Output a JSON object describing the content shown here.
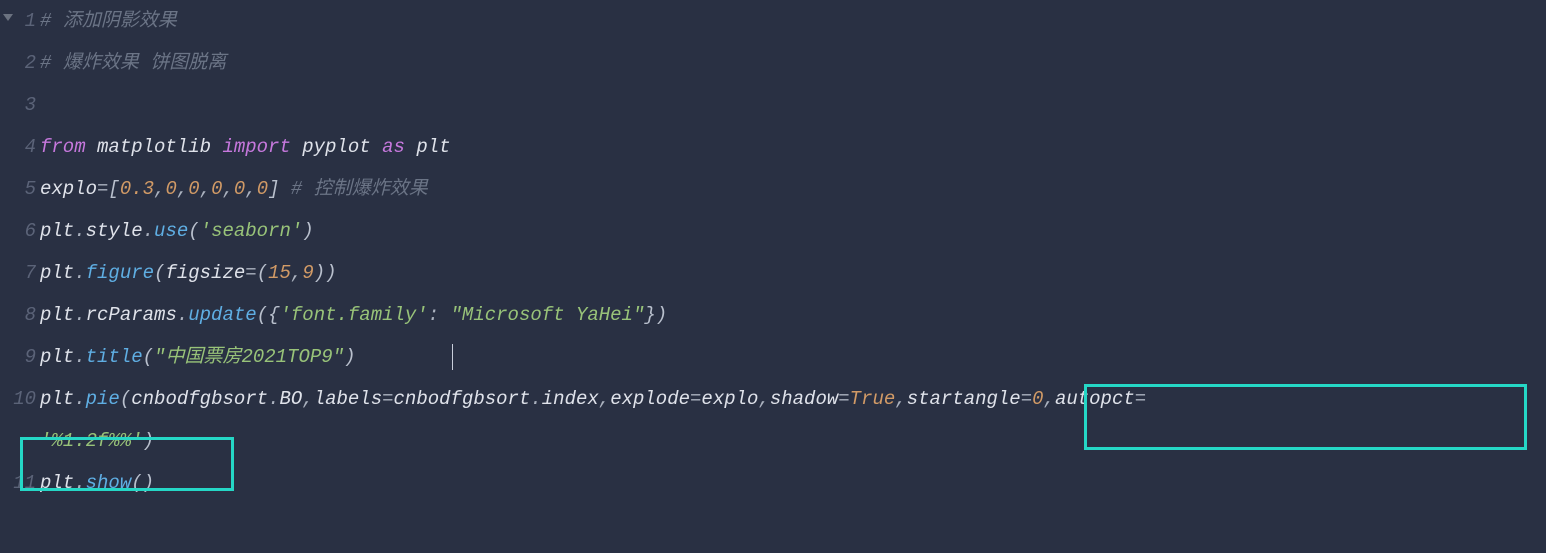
{
  "gutter": {
    "l1": "1",
    "l2": "2",
    "l3": "3",
    "l4": "4",
    "l5": "5",
    "l6": "6",
    "l7": "7",
    "l8": "8",
    "l9": "9",
    "l10": "10",
    "l11": "11"
  },
  "code": {
    "c1_hash": "#",
    "c1_sp": " ",
    "c1_txt": "添加阴影效果",
    "c2_hash": "#",
    "c2_sp": " ",
    "c2_txt": "爆炸效果 饼图脱离",
    "c4_from": "from",
    "c4_mod": "matplotlib",
    "c4_import": "import",
    "c4_sub": "pyplot",
    "c4_as": "as",
    "c4_alias": "plt",
    "c5_name": "explo",
    "c5_eq": "=",
    "c5_lb": "[",
    "c5_n0": "0.3",
    "c5_c": ",",
    "c5_n1": "0",
    "c5_n2": "0",
    "c5_n3": "0",
    "c5_n4": "0",
    "c5_n5": "0",
    "c5_rb": "]",
    "c5_sp": "  ",
    "c5_com": "# 控制爆炸效果",
    "c6_plt": "plt",
    "c6_dot": ".",
    "c6_style": "style",
    "c6_use": "use",
    "c6_lp": "(",
    "c6_arg": "'seaborn'",
    "c6_rp": ")",
    "c7_plt": "plt",
    "c7_dot": ".",
    "c7_fig": "figure",
    "c7_lp": "(",
    "c7_kw": "figsize",
    "c7_eq": "=",
    "c7_lp2": "(",
    "c7_n1": "15",
    "c7_c": ",",
    "c7_n2": "9",
    "c7_rp2": ")",
    "c7_rp": ")",
    "c8_plt": "plt",
    "c8_dot": ".",
    "c8_rc": "rcParams",
    "c8_upd": "update",
    "c8_lp": "(",
    "c8_lb": "{",
    "c8_key": "'font.family'",
    "c8_col": ":",
    "c8_val": "\"Microsoft YaHei\"",
    "c8_rb": "}",
    "c8_rp": ")",
    "c9_plt": "plt",
    "c9_dot": ".",
    "c9_title": "title",
    "c9_lp": "(",
    "c9_arg": "\"中国票房2021TOP9\"",
    "c9_rp": ")",
    "c10_plt": "plt",
    "c10_dot": ".",
    "c10_pie": "pie",
    "c10_lp": "(",
    "c10_a1a": "cnbodfgbsort",
    "c10_a1b": "BO",
    "c10_c": ",",
    "c10_l": "labels",
    "c10_eq": "=",
    "c10_a2a": "cnbodfgbsort",
    "c10_a2b": "index",
    "c10_exp": "explode",
    "c10_expv": "explo",
    "c10_sh": "shadow",
    "c10_shv": "True",
    "c10_sa": "startangle",
    "c10_sav": "0",
    "c10_ap": "autopct",
    "c10b_val": "'%1.2f%%'",
    "c10b_rp": ")",
    "c11_plt": "plt",
    "c11_dot": ".",
    "c11_show": "show",
    "c11_lp": "(",
    "c11_rp": ")"
  }
}
